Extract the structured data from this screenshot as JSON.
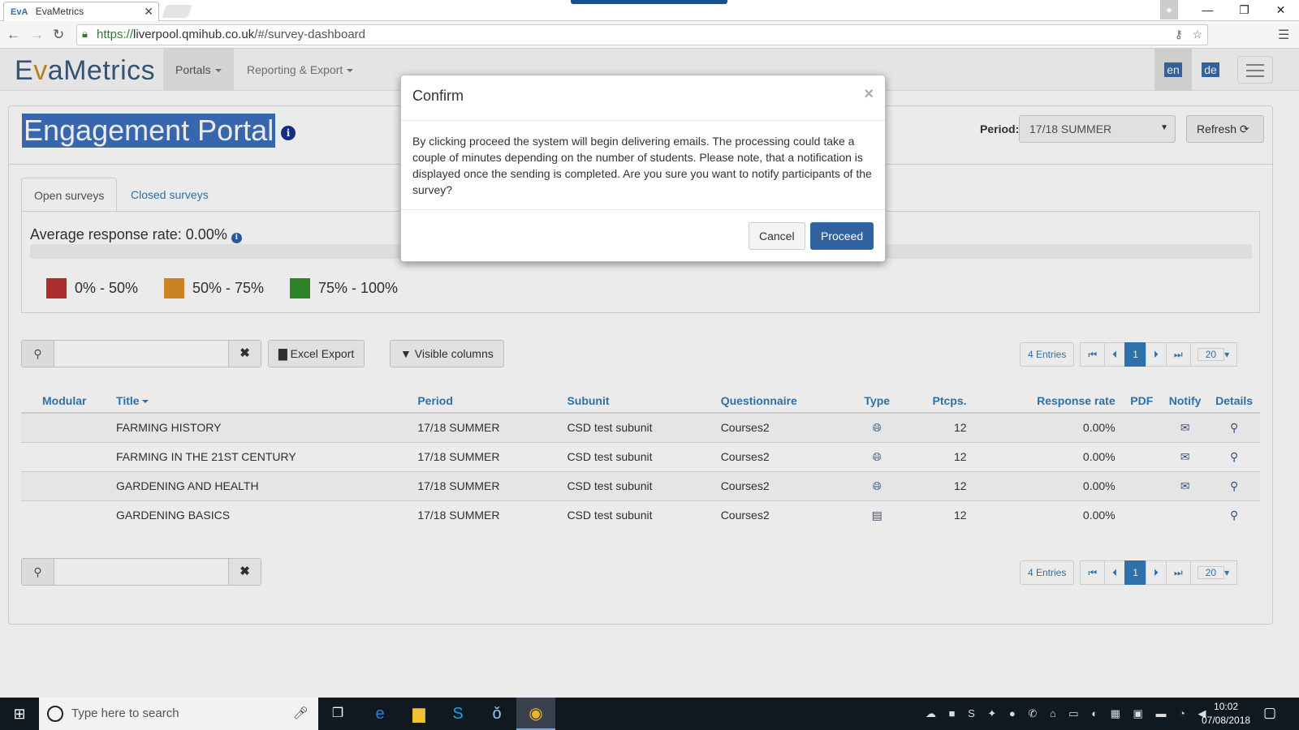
{
  "browser": {
    "tab_title": "EvaMetrics",
    "tab_favicon": "EvA",
    "url_scheme": "https://",
    "url_host": "liverpool.qmihub.co.uk",
    "url_path": "/#/survey-dashboard"
  },
  "navbar": {
    "logo_pre": "E",
    "logo_v": "v",
    "logo_post": "aMetrics",
    "portals": "Portals",
    "reporting": "Reporting & Export",
    "lang_en": "en",
    "lang_de": "de"
  },
  "page": {
    "title": "Engagement Portal",
    "period_label": "Period:",
    "period_value": "17/18 SUMMER",
    "refresh": "Refresh",
    "tab_open": "Open surveys",
    "tab_closed": "Closed surveys",
    "avg_rate": "Average response rate: 0.00%",
    "avg_rate_value": 0,
    "legend": [
      {
        "label": "0% - 50%",
        "color": "#b93232"
      },
      {
        "label": "50% - 75%",
        "color": "#d99028"
      },
      {
        "label": "75% - 100%",
        "color": "#2f8f2f"
      }
    ]
  },
  "toolbar": {
    "search_value": "",
    "excel_export": "Excel Export",
    "visible_columns": "Visible columns"
  },
  "pager": {
    "entries": "4 Entries",
    "current": "1",
    "page_size": "20"
  },
  "table": {
    "headers": {
      "modular": "Modular",
      "title": "Title",
      "period": "Period",
      "subunit": "Subunit",
      "questionnaire": "Questionnaire",
      "type": "Type",
      "ptcps": "Ptcps.",
      "response_rate": "Response rate",
      "pdf": "PDF",
      "notify": "Notify",
      "details": "Details"
    },
    "rows": [
      {
        "title": "FARMING HISTORY",
        "period": "17/18 SUMMER",
        "subunit": "CSD test subunit",
        "questionnaire": "Courses2",
        "type_icon": "globe-icon",
        "ptcps": "12",
        "rate": "0.00%",
        "notify": true
      },
      {
        "title": "FARMING IN THE 21ST CENTURY",
        "period": "17/18 SUMMER",
        "subunit": "CSD test subunit",
        "questionnaire": "Courses2",
        "type_icon": "globe-icon",
        "ptcps": "12",
        "rate": "0.00%",
        "notify": true
      },
      {
        "title": "GARDENING AND HEALTH",
        "period": "17/18 SUMMER",
        "subunit": "CSD test subunit",
        "questionnaire": "Courses2",
        "type_icon": "globe-icon",
        "ptcps": "12",
        "rate": "0.00%",
        "notify": true
      },
      {
        "title": "GARDENING BASICS",
        "period": "17/18 SUMMER",
        "subunit": "CSD test subunit",
        "questionnaire": "Courses2",
        "type_icon": "paper-icon",
        "ptcps": "12",
        "rate": "0.00%",
        "notify": false
      }
    ]
  },
  "modal": {
    "title": "Confirm",
    "body": "By clicking proceed the system will begin delivering emails. The processing could take a couple of minutes depending on the number of students. Please note, that a notification is displayed once the sending is completed. Are you sure you want to notify participants of the survey?",
    "cancel": "Cancel",
    "proceed": "Proceed"
  },
  "taskbar": {
    "search_placeholder": "Type here to search",
    "time": "10:02",
    "date": "07/08/2018"
  }
}
